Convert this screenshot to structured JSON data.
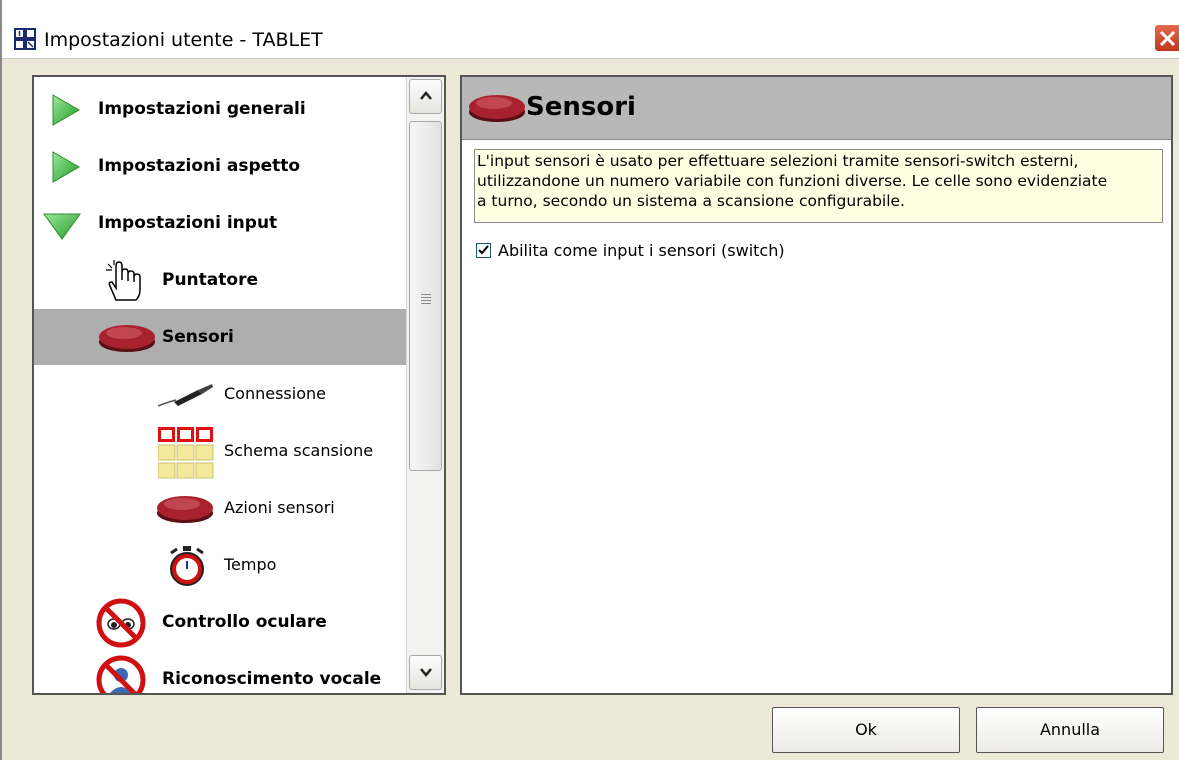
{
  "window": {
    "title": "Impostazioni utente - TABLET"
  },
  "tree": {
    "items": [
      {
        "label": "Impostazioni generali",
        "icon": "green-arrow-right-icon"
      },
      {
        "label": "Impostazioni aspetto",
        "icon": "green-arrow-right-icon"
      },
      {
        "label": "Impostazioni input",
        "icon": "green-arrow-down-icon"
      },
      {
        "label": "Puntatore",
        "icon": "hand-pointer-icon"
      },
      {
        "label": "Sensori",
        "icon": "red-switch-button-icon",
        "selected": true
      },
      {
        "label": "Connessione",
        "icon": "jack-cable-icon"
      },
      {
        "label": "Schema scansione",
        "icon": "scan-grid-icon"
      },
      {
        "label": "Azioni sensori",
        "icon": "red-switch-button-icon"
      },
      {
        "label": "Tempo",
        "icon": "stopwatch-icon"
      },
      {
        "label": "Controllo oculare",
        "icon": "eye-disabled-icon"
      },
      {
        "label": "Riconoscimento vocale",
        "icon": "voice-disabled-icon"
      }
    ]
  },
  "content": {
    "title": "Sensori",
    "description_lines": [
      "L'input sensori è usato per effettuare selezioni tramite sensori-switch esterni,",
      "utilizzandone un numero variabile con funzioni diverse. Le celle sono evidenziate",
      "a turno, secondo un sistema a scansione configurabile."
    ],
    "checkbox": {
      "label": "Abilita come input i sensori (switch)",
      "checked": true
    }
  },
  "buttons": {
    "ok": "Ok",
    "cancel": "Annulla"
  },
  "colors": {
    "selected_row": "#aeaeae",
    "header_bg": "#b8b8b8",
    "info_bg": "#ffffe4",
    "window_bg": "#ece9d8"
  }
}
